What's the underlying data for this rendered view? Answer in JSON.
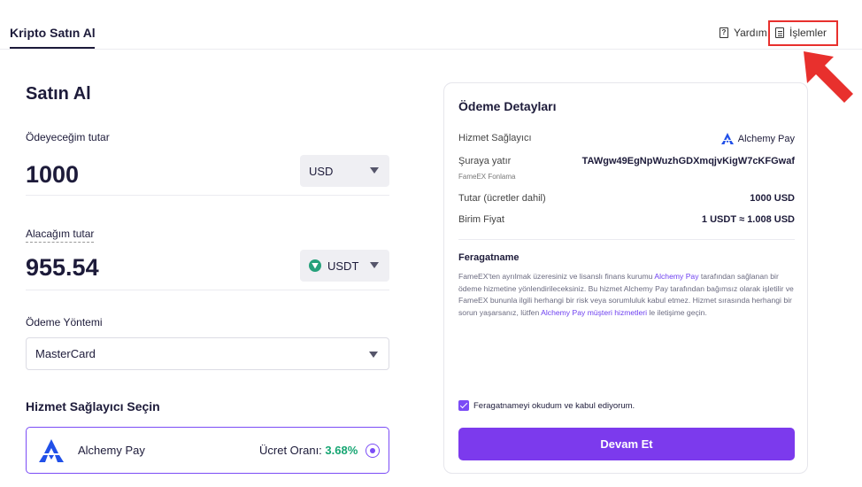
{
  "header": {
    "active_tab": "Kripto Satın Al",
    "help_label": "Yardım",
    "transactions_label": "İşlemler",
    "help_icon": "question-doc-icon",
    "transactions_icon": "document-icon"
  },
  "buy": {
    "title": "Satın Al",
    "pay_label": "Ödeyeceğim tutar",
    "pay_amount": "1000",
    "pay_currency": "USD",
    "receive_label": "Alacağım tutar",
    "receive_amount": "955.54",
    "receive_currency": "USDT",
    "receive_currency_icon": "usdt-icon",
    "method_label": "Ödeme Yöntemi",
    "method_value": "MasterCard",
    "provider_heading": "Hizmet Sağlayıcı Seçin",
    "provider": {
      "name": "Alchemy Pay",
      "fee_label": "Ücret Oranı:",
      "fee_value": "3.68%"
    }
  },
  "details": {
    "title": "Ödeme Detayları",
    "provider_label": "Hizmet Sağlayıcı",
    "provider_value": "Alchemy Pay",
    "deposit_label": "Şuraya yatır",
    "deposit_value": "TAWgw49EgNpWuzhGDXmqjvKigW7cKFGwaf",
    "deposit_sub": "FameEX Fonlama",
    "amount_label": "Tutar (ücretler dahil)",
    "amount_value": "1000 USD",
    "unit_price_label": "Birim Fiyat",
    "unit_price_value": "1 USDT ≈ 1.008 USD",
    "disclaimer_title": "Feragatname",
    "disclaimer": {
      "p1": "FameEX'ten ayrılmak üzeresiniz ve lisanslı finans kurumu ",
      "link1": "Alchemy Pay",
      "p2": " tarafından sağlanan bir ödeme hizmetine yönlendirileceksiniz. Bu hizmet Alchemy Pay tarafından bağımsız olarak işletilir ve FameEX bununla ilgili herhangi bir risk veya sorumluluk kabul etmez. Hizmet sırasında herhangi bir sorun yaşarsanız, lütfen ",
      "link2": "Alchemy Pay müşteri hizmetleri",
      "p3": " le iletişime geçin."
    },
    "agree_label": "Feragatnameyi okudum ve kabul ediyorum.",
    "agree_checked": true,
    "continue_label": "Devam Et"
  },
  "colors": {
    "accent": "#7c3aed",
    "highlight": "#e8302d",
    "fee": "#17a673"
  }
}
